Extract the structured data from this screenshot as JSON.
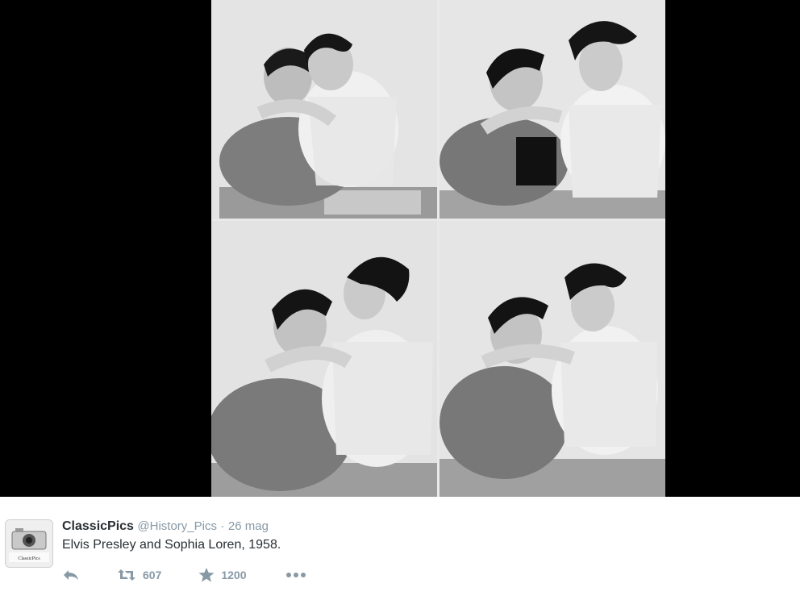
{
  "media": {
    "photos": [
      {
        "name": "collage-photo-1"
      },
      {
        "name": "collage-photo-2"
      },
      {
        "name": "collage-photo-3"
      },
      {
        "name": "collage-photo-4"
      }
    ]
  },
  "tweet": {
    "author_name": "ClassicPics",
    "author_handle": "@History_Pics",
    "separator": "·",
    "timestamp": "26 mag",
    "text": "Elvis Presley and Sophia Loren, 1958.",
    "avatar_label": "ClassicPics",
    "actions": {
      "reply_icon": "reply-icon",
      "retweet_icon": "retweet-icon",
      "retweet_count": "607",
      "favorite_icon": "star-icon",
      "favorite_count": "1200",
      "more_icon": "more-icon"
    }
  },
  "colors": {
    "media_background": "#000000",
    "name": "#292f33",
    "meta_gray": "#8899a6"
  }
}
